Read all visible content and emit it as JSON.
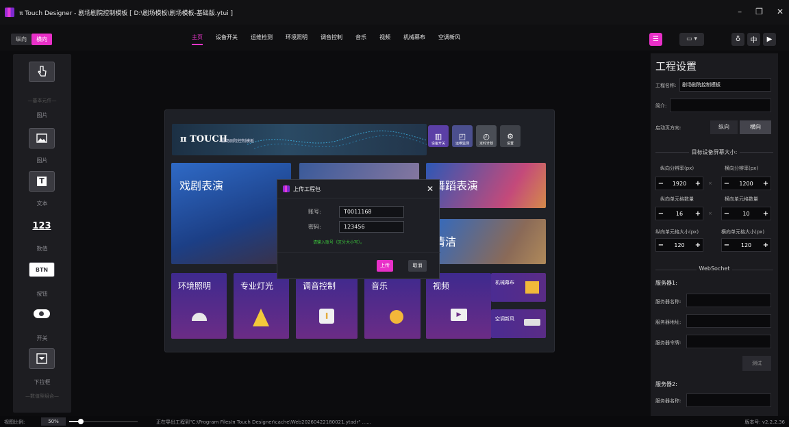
{
  "window": {
    "title": "π Touch Designer - 剧场剧院控制模板 [ D:\\剧场模板\\剧场模板-基础版.ytui ]"
  },
  "orientation": {
    "portrait": "纵向",
    "landscape": "横向"
  },
  "nav": {
    "tabs": [
      "主页",
      "设备开关",
      "运维检测",
      "环境照明",
      "调音控制",
      "音乐",
      "视频",
      "机械幕布",
      "空调新风"
    ],
    "active": "主页"
  },
  "toolbox": {
    "section_basic": "—基本元件—",
    "section_combo": "—数值型组合—",
    "items": [
      {
        "icon": "hand-pointer-icon",
        "label": "图片"
      },
      {
        "icon": "image-icon",
        "label": "图片"
      },
      {
        "icon": "text-icon",
        "label": "文本"
      },
      {
        "icon": "number-icon",
        "glyph": "123",
        "label": "数值"
      },
      {
        "icon": "button-icon",
        "glyph": "BTN",
        "label": "按钮"
      },
      {
        "icon": "toggle-icon",
        "label": "开关"
      },
      {
        "icon": "dropdown-icon",
        "label": "下拉框"
      }
    ]
  },
  "preview": {
    "banner_logo": "π TOUCH",
    "banner_sub": "剧场剧院控制模板",
    "shortcuts": [
      {
        "icon": "device-switch-icon",
        "label": "设备开关"
      },
      {
        "icon": "monitor-icon",
        "label": "运维监测"
      },
      {
        "icon": "timer-icon",
        "label": "定时计划"
      },
      {
        "icon": "settings-icon",
        "label": "设置"
      }
    ],
    "cards": {
      "drama": "戏剧表演",
      "dance": "舞蹈表演",
      "clean": "清洁",
      "lighting": "环境照明",
      "pro_light": "专业灯光",
      "mixer": "调音控制",
      "music": "音乐",
      "video": "视频",
      "curtain": "机械幕布",
      "hvac": "空调新风"
    }
  },
  "dialog": {
    "title": "上传工程包",
    "account_label": "账号:",
    "account_value": "T0011168",
    "password_label": "密码:",
    "password_value": "123456",
    "hint": "请输入账号（区分大小写）。",
    "upload": "上传",
    "cancel": "取消"
  },
  "props": {
    "title": "工程设置",
    "name_label": "工程名称:",
    "name_value": "剧场剧院控制模板",
    "desc_label": "简介:",
    "start_dir_label": "启动页方向:",
    "dir_portrait": "纵向",
    "dir_landscape": "横向",
    "screen_section": "目标设备屏幕大小:",
    "res_v_label": "纵向分辨率(px)",
    "res_h_label": "横向分辨率(px)",
    "res_v": "1920",
    "res_h": "1200",
    "cells_v_label": "纵向单元格数量",
    "cells_h_label": "横向单元格数量",
    "cells_v": "16",
    "cells_h": "10",
    "cellsize_v_label": "纵向单元格大小(px)",
    "cellsize_h_label": "横向单元格大小(px)",
    "cellsize_v": "120",
    "cellsize_h": "120",
    "ws_section": "WebSochet",
    "server1": "服务器1:",
    "server_name": "服务器名称:",
    "server_addr": "服务器地址:",
    "server_token": "服务器令牌:",
    "test": "测试",
    "server2": "服务器2:",
    "server2_name": "服务器名称:"
  },
  "status": {
    "zoom_label": "视图比例:",
    "zoom": "50%",
    "message": "正在导出工程到\"C:\\Program Files\\π Touch Designer\\cache\\Web20260422180021.ytadr\" ......",
    "version": "版本号: v2.2.2.36"
  },
  "colors": {
    "accent": "#e830c8",
    "dialog_hint": "#3cc83c"
  }
}
